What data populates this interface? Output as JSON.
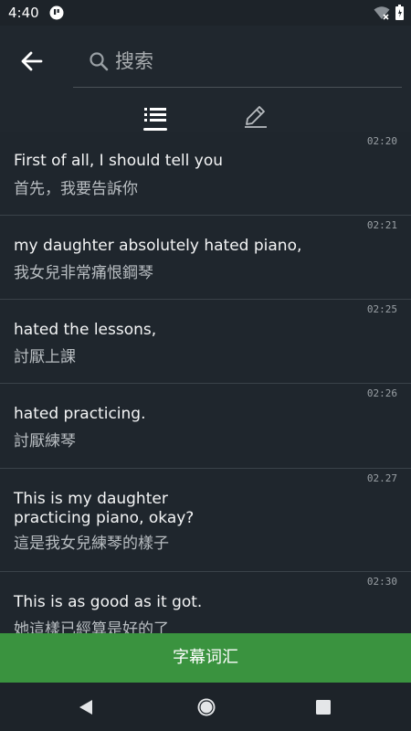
{
  "status_bar": {
    "time": "4:40"
  },
  "search": {
    "placeholder": "搜索",
    "value": ""
  },
  "tabs": [
    {
      "icon": "list-icon",
      "selected": true
    },
    {
      "icon": "pencil-icon",
      "selected": false
    }
  ],
  "items": [
    {
      "time": "02:20",
      "english": "First of all, I should tell you",
      "chinese": "首先，我要告訴你"
    },
    {
      "time": "02:21",
      "english": "my daughter absolutely hated piano,",
      "chinese": "我女兒非常痛恨鋼琴"
    },
    {
      "time": "02:25",
      "english": "hated the lessons,",
      "chinese": "討厭上課"
    },
    {
      "time": "02:26",
      "english": "hated practicing.",
      "chinese": "討厭練琴"
    },
    {
      "time": "02.27",
      "english": "This is my daughter\npracticing piano, okay?",
      "chinese": "這是我女兒練琴的樣子"
    },
    {
      "time": "02:30",
      "english": "This is as good as it got.",
      "chinese": "她這樣已經算是好的了"
    }
  ],
  "bottom_button": {
    "label": "字幕词汇"
  },
  "colors": {
    "accent": "#3a933f",
    "background": "#1f262d",
    "divider": "#3a4249"
  }
}
